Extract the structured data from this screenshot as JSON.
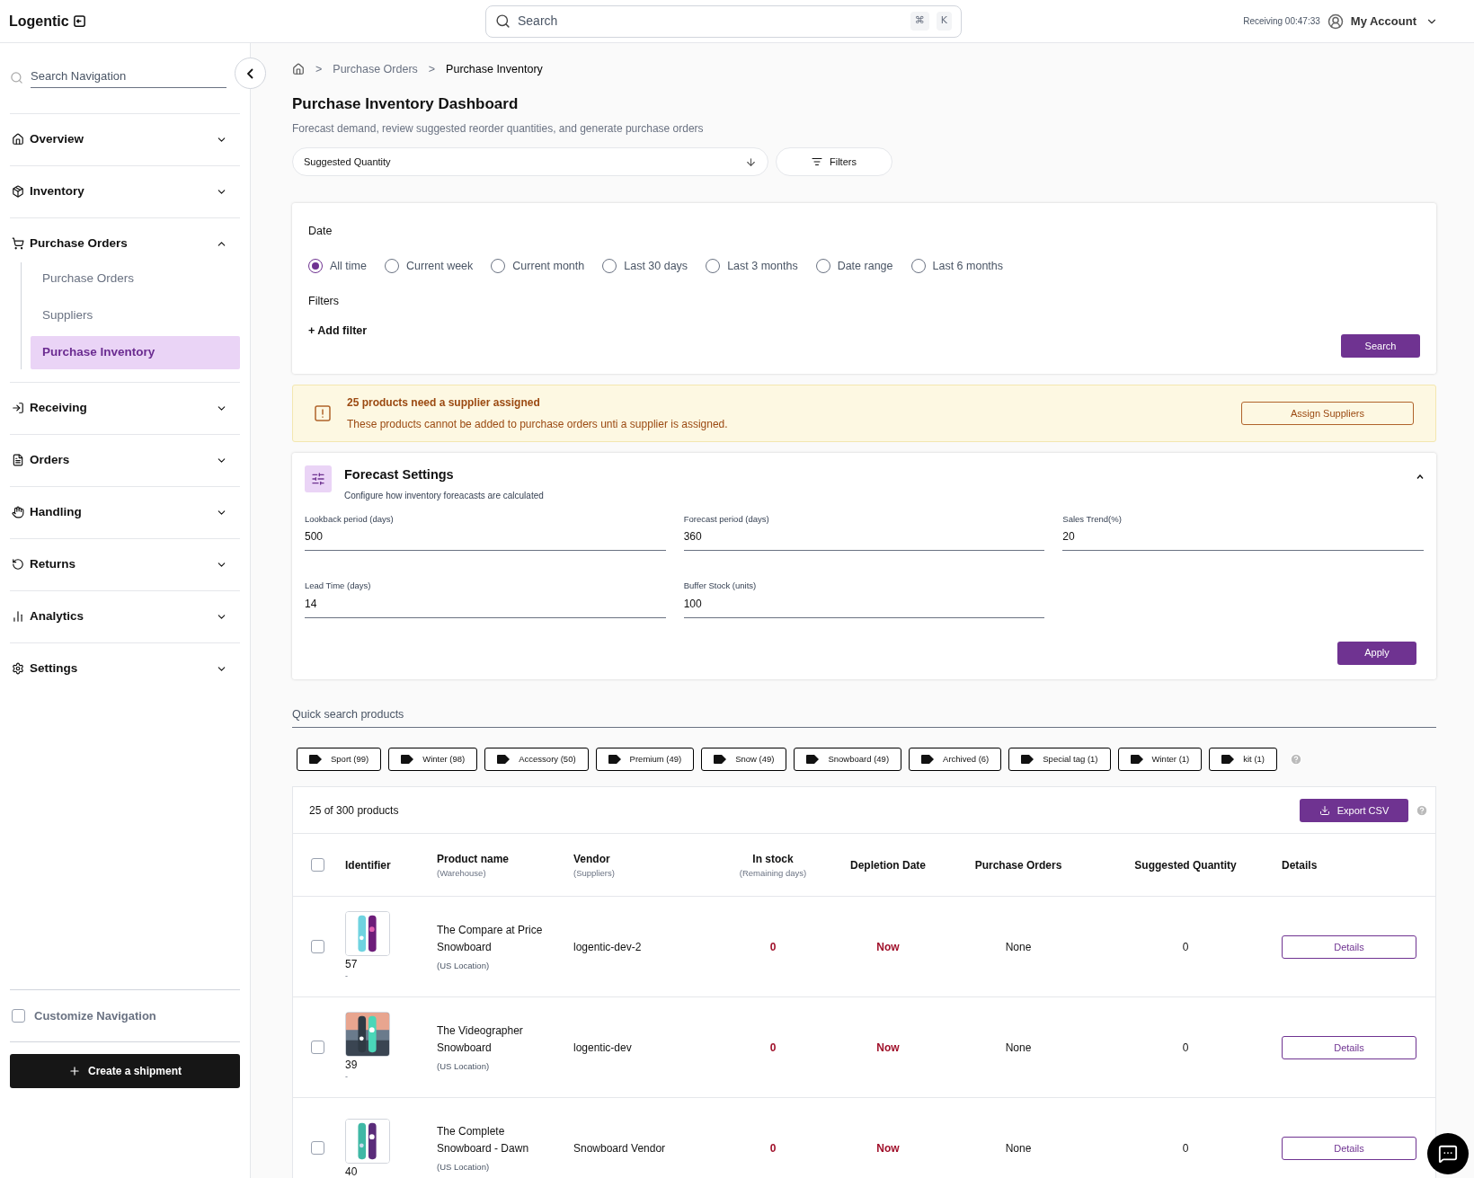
{
  "header": {
    "logo": "Logentic",
    "search": {
      "placeholder": "Search",
      "shortcut": [
        "⌘",
        "K"
      ]
    },
    "timer": "Receiving 00:47:33",
    "account": "My Account"
  },
  "sidebar": {
    "search": {
      "placeholder": "Search Navigation"
    },
    "items": [
      {
        "label": "Overview",
        "expanded": false
      },
      {
        "label": "Inventory",
        "expanded": false
      },
      {
        "label": "Purchase Orders",
        "expanded": true,
        "children": [
          {
            "label": "Purchase Orders",
            "selected": false
          },
          {
            "label": "Suppliers",
            "selected": false
          },
          {
            "label": "Purchase Inventory",
            "selected": true
          }
        ]
      },
      {
        "label": "Receiving",
        "expanded": false
      },
      {
        "label": "Orders",
        "expanded": false
      },
      {
        "label": "Handling",
        "expanded": false
      },
      {
        "label": "Returns",
        "expanded": false
      },
      {
        "label": "Analytics",
        "expanded": false
      },
      {
        "label": "Settings",
        "expanded": false
      }
    ],
    "customize": {
      "label": "Customize Navigation",
      "checked": false
    },
    "create_button": "Create a shipment"
  },
  "breadcrumb": [
    {
      "separator": ">",
      "label": "Purchase Orders"
    },
    {
      "separator": ">",
      "label": "Purchase Inventory"
    }
  ],
  "page": {
    "title": "Purchase Inventory Dashboard",
    "subtitle": "Forecast demand, review suggested reorder quantities, and generate purchase orders"
  },
  "sort": {
    "value": "Suggested Quantity"
  },
  "filters_button": "Filters",
  "date_filter": {
    "label": "Date",
    "options": [
      {
        "label": "All time",
        "selected": true
      },
      {
        "label": "Current week",
        "selected": false
      },
      {
        "label": "Current month",
        "selected": false
      },
      {
        "label": "Last 30 days",
        "selected": false
      },
      {
        "label": "Last 3 months",
        "selected": false
      },
      {
        "label": "Date range",
        "selected": false
      },
      {
        "label": "Last 6 months",
        "selected": false
      }
    ]
  },
  "filters": {
    "label": "Filters",
    "add": "+ Add filter"
  },
  "search_button": "Search",
  "alert": {
    "title": "25 products need a supplier assigned",
    "message": "These products cannot be added to purchase orders unti a supplier is assigned.",
    "button": "Assign Suppliers"
  },
  "forecast": {
    "title": "Forecast Settings",
    "subtitle": "Configure how inventory foreacasts are calculated",
    "expanded": true,
    "fields": [
      {
        "label": "Lookback period (days)",
        "value": "500"
      },
      {
        "label": "Forecast period (days)",
        "value": "360"
      },
      {
        "label": "Sales Trend(%)",
        "value": "20"
      },
      {
        "label": "Lead Time (days)",
        "value": "14"
      },
      {
        "label": "Buffer Stock (units)",
        "value": "100"
      }
    ],
    "apply": "Apply"
  },
  "quick_search": {
    "label": "Quick search products",
    "tags": [
      {
        "label": "Sport (99)"
      },
      {
        "label": "Winter (98)"
      },
      {
        "label": "Accessory (50)"
      },
      {
        "label": "Premium (49)"
      },
      {
        "label": "Snow (49)"
      },
      {
        "label": "Snowboard (49)"
      },
      {
        "label": "Archived (6)"
      },
      {
        "label": "Special tag (1)"
      },
      {
        "label": "Winter (1)"
      },
      {
        "label": "kit (1)"
      }
    ]
  },
  "table": {
    "select_all_checked": false,
    "count": "25 of 300 products",
    "export": "Export CSV",
    "columns": [
      {
        "label": "Identifier"
      },
      {
        "label": "Product name",
        "sub": "(Warehouse)"
      },
      {
        "label": "Vendor",
        "sub": "(Suppliers)"
      },
      {
        "label": "In stock",
        "sub": "(Remaining days)"
      },
      {
        "label": "Depletion Date"
      },
      {
        "label": "Purchase Orders"
      },
      {
        "label": "Suggested Quantity"
      },
      {
        "label": "Details"
      }
    ],
    "rows": [
      {
        "checked": false,
        "id": "57",
        "id_sub": "-",
        "name": "The Compare at Price Snowboard",
        "location": "(US Location)",
        "vendor": "logentic-dev-2",
        "in_stock": "0",
        "depletion": "Now",
        "purchase_orders": "None",
        "suggested": "0",
        "details": "Details"
      },
      {
        "checked": false,
        "id": "39",
        "id_sub": "-",
        "name": "The Videographer Snowboard",
        "location": "(US Location)",
        "vendor": "logentic-dev",
        "in_stock": "0",
        "depletion": "Now",
        "purchase_orders": "None",
        "suggested": "0",
        "details": "Details"
      },
      {
        "checked": false,
        "id": "40",
        "name": "The Complete Snowboard - Dawn",
        "location": "(US Location)",
        "vendor": "Snowboard Vendor",
        "in_stock": "0",
        "depletion": "Now",
        "purchase_orders": "None",
        "suggested": "0",
        "details": "Details"
      }
    ]
  }
}
